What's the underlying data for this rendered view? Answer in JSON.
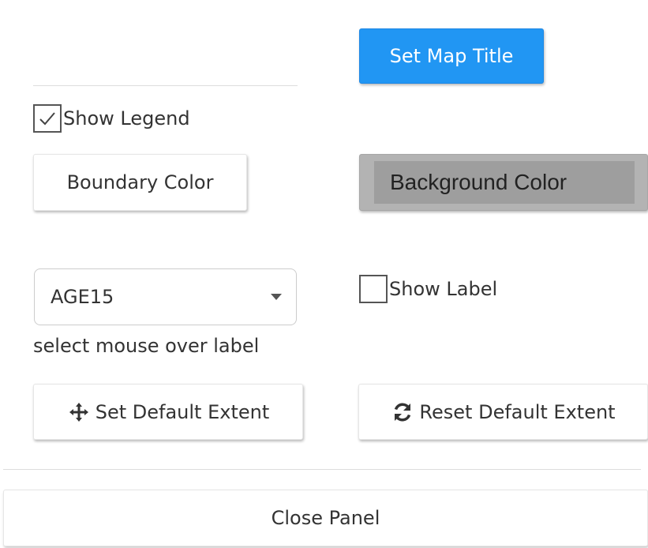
{
  "panel": {
    "set_title_label": "Set Map Title",
    "show_legend": {
      "label": "Show Legend",
      "checked": true
    },
    "boundary_color_label": "Boundary Color",
    "background_color_label": "Background Color",
    "label_select": {
      "selected": "AGE15"
    },
    "show_label": {
      "label": "Show Label",
      "checked": false
    },
    "select_helper": "select mouse over label",
    "set_default_extent_label": "Set Default Extent",
    "reset_default_extent_label": "Reset Default Extent",
    "close_panel_label": "Close Panel"
  },
  "colors": {
    "primary": "#2196f3",
    "background_button": "#b3b3b3"
  },
  "icons": {
    "set_extent": "crosshair-move-icon",
    "reset_extent": "refresh-icon",
    "checkmark": "checkmark-icon",
    "dropdown": "caret-down-icon"
  }
}
